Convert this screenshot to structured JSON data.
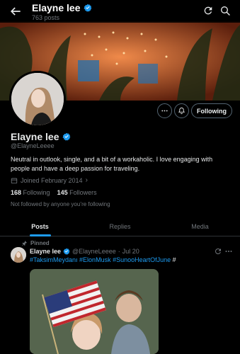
{
  "header": {
    "title": "Elayne lee",
    "post_count": "763 posts"
  },
  "profile": {
    "name": "Elayne lee",
    "handle": "@ElayneLeeee",
    "bio": "Neutral in outlook, single, and a bit of a workaholic. I love engaging with people and have a deep passion for traveling.",
    "joined": "Joined February 2014",
    "following_count": "168",
    "following_label": "Following",
    "followers_count": "145",
    "followers_label": "Followers",
    "not_followed": "Not followed by anyone you’re following",
    "follow_button": "Following"
  },
  "tabs": [
    {
      "label": "Posts",
      "active": true
    },
    {
      "label": "Replies",
      "active": false
    },
    {
      "label": "Media",
      "active": false
    }
  ],
  "pinned_post": {
    "pinned_label": "Pinned",
    "author_name": "Elayne lee",
    "author_handle": "@ElayneLeeee",
    "separator": "·",
    "date": "Jul 20",
    "hashtag_1": "#TaksimMeydanı",
    "hashtag_2": "#ElonMusk",
    "hashtag_3": "#SunooHeartOfJune",
    "hashtag_trailing": "#"
  },
  "colors": {
    "accent": "#1d9bf0",
    "background": "#000000",
    "secondary_text": "#71767b",
    "verified_badge": "#1d9bf0"
  },
  "icons": {
    "back": "arrow-left-icon",
    "refresh": "refresh-icon",
    "search": "search-icon",
    "more": "more-horizontal-icon",
    "notify": "notification-add-icon",
    "calendar": "calendar-icon",
    "pin": "pin-icon",
    "verified": "verified-badge-icon"
  }
}
